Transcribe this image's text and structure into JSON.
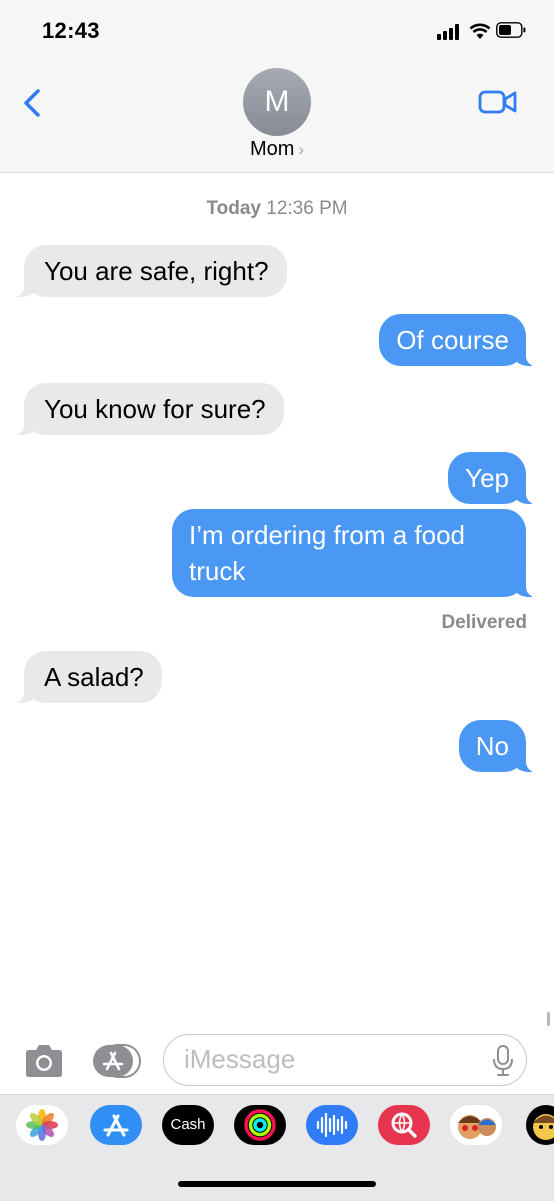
{
  "status_bar": {
    "time": "12:43"
  },
  "header": {
    "avatar_initial": "M",
    "contact_name": "Mom",
    "chevron": "›"
  },
  "thread": {
    "timestamp_day": "Today",
    "timestamp_time": "12:36 PM",
    "messages": [
      {
        "direction": "incoming",
        "text": "You are safe, right?"
      },
      {
        "direction": "outgoing",
        "text": "Of course"
      },
      {
        "direction": "incoming",
        "text": "You know for sure?"
      },
      {
        "direction": "outgoing",
        "text": "Yep"
      },
      {
        "direction": "outgoing",
        "text": "I’m ordering from a food truck"
      },
      {
        "direction": "incoming",
        "text": "A salad?"
      },
      {
        "direction": "outgoing",
        "text": "No"
      }
    ],
    "delivery_status": "Delivered"
  },
  "compose": {
    "placeholder": "iMessage"
  },
  "app_drawer": {
    "apps": [
      {
        "name": "photos-app-icon"
      },
      {
        "name": "app-store-icon"
      },
      {
        "name": "apple-cash-icon",
        "label": "Cash"
      },
      {
        "name": "activity-icon"
      },
      {
        "name": "audio-message-icon"
      },
      {
        "name": "web-search-icon"
      },
      {
        "name": "memoji-stickers-icon"
      },
      {
        "name": "animoji-icon"
      }
    ]
  },
  "colors": {
    "outgoing_bubble": "#4a97f4",
    "incoming_bubble": "#e9e9eb",
    "accent": "#2f7cf6"
  }
}
